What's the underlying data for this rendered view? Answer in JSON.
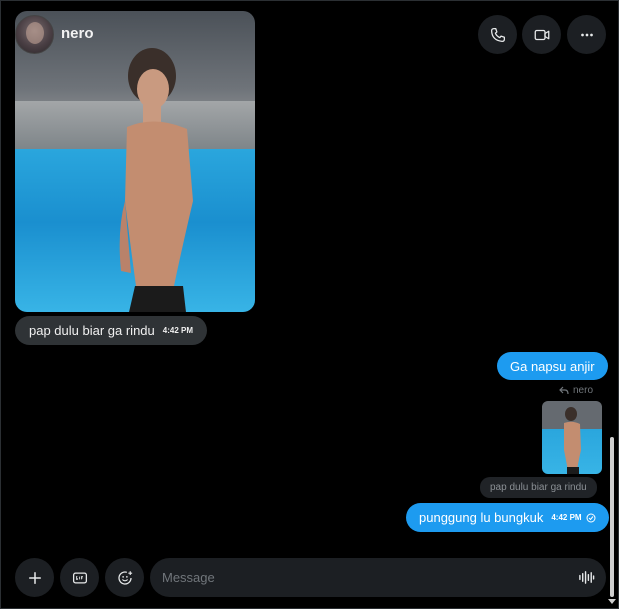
{
  "conversation": {
    "contact_name": "nero"
  },
  "header": {
    "icons": [
      "phone-icon",
      "video-icon",
      "more-icon"
    ]
  },
  "messages": {
    "incoming_text": "pap dulu biar ga rindu",
    "incoming_time": "4:42 PM",
    "outgoing_1_text": "Ga napsu anjir",
    "reply_to_label": "nero",
    "quoted_text": "pap dulu biar ga rindu",
    "outgoing_2_text": "punggung lu bungkuk",
    "outgoing_2_time": "4:42 PM"
  },
  "composer": {
    "placeholder": "Message",
    "icons": [
      "add-icon",
      "gif-icon",
      "emoji-icon",
      "voice-icon"
    ]
  },
  "colors": {
    "background": "#000000",
    "outgoing_bubble": "#1d9bf0",
    "incoming_bubble": "#2f3336",
    "button_bg": "#1c1f23"
  }
}
